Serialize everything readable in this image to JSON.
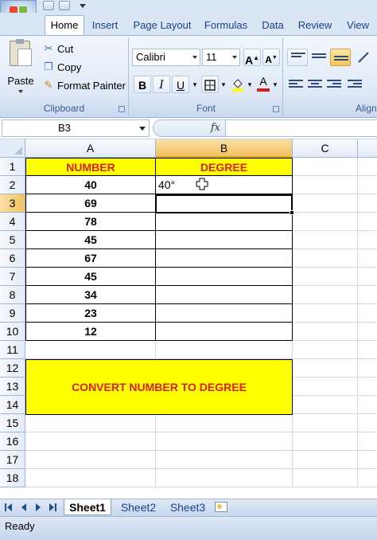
{
  "ribbon": {
    "tabs": [
      "Home",
      "Insert",
      "Page Layout",
      "Formulas",
      "Data",
      "Review",
      "View"
    ],
    "clipboard": {
      "paste": "Paste",
      "cut": "Cut",
      "copy": "Copy",
      "format_painter": "Format Painter",
      "label": "Clipboard"
    },
    "font": {
      "name": "Calibri",
      "size": "11",
      "bold": "B",
      "italic": "I",
      "underline": "U",
      "color_glyph": "A",
      "label": "Font"
    },
    "alignment": {
      "label": "Align"
    }
  },
  "formula_bar": {
    "name_box": "B3",
    "fx": "fx",
    "content": ""
  },
  "grid": {
    "columns": [
      "A",
      "B",
      "C"
    ],
    "rows": [
      "1",
      "2",
      "3",
      "4",
      "5",
      "6",
      "7",
      "8",
      "9",
      "10",
      "11",
      "12",
      "13",
      "14",
      "15",
      "16",
      "17",
      "18"
    ],
    "header_a": "NUMBER",
    "header_b": "DEGREE",
    "numbers": [
      "40",
      "69",
      "78",
      "45",
      "67",
      "45",
      "34",
      "23",
      "12"
    ],
    "b2_value": "40°",
    "banner": "CONVERT NUMBER TO DEGREE"
  },
  "sheets": {
    "tabs": [
      "Sheet1",
      "Sheet2",
      "Sheet3"
    ],
    "active": "Sheet1"
  },
  "status": {
    "text": "Ready"
  },
  "colors": {
    "header_fill": "#ffff00",
    "header_text": "#e21c1c",
    "accent": "#15428b"
  }
}
